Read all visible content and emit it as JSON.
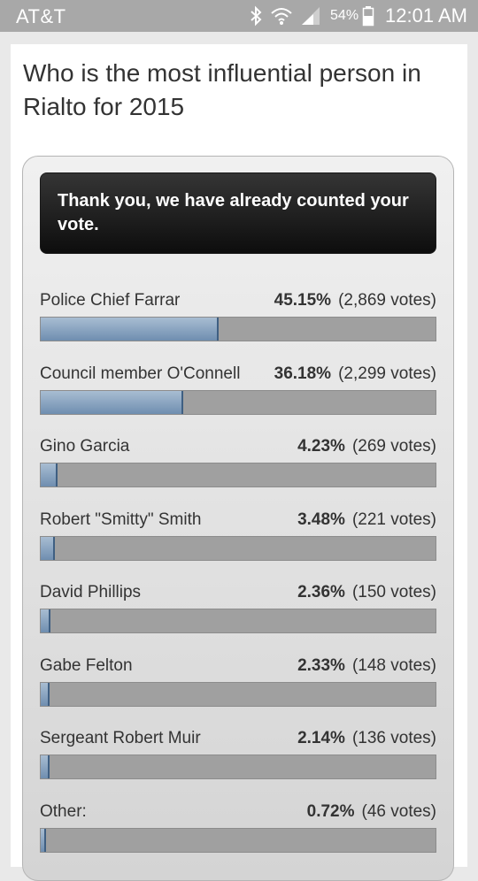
{
  "status_bar": {
    "carrier": "AT&T",
    "icons": [
      "bluetooth-icon",
      "wifi-icon",
      "signal-icon",
      "battery-icon"
    ],
    "battery": "54%",
    "time": "12:01 AM"
  },
  "poll": {
    "question": "Who is the most influential person in Rialto for 2015",
    "message": "Thank you, we have already counted your vote.",
    "colors": {
      "bar_fill": "#7f9cbd",
      "bar_track": "#a0a0a0",
      "message_bg": "#1a1a1a"
    },
    "results": [
      {
        "name": "Police Chief Farrar",
        "percent": "45.15%",
        "votes": "(2,869 votes)",
        "fraction": 0.4515
      },
      {
        "name": "Council member O'Connell",
        "percent": "36.18%",
        "votes": "(2,299 votes)",
        "fraction": 0.3618
      },
      {
        "name": "Gino Garcia",
        "percent": "4.23%",
        "votes": "(269 votes)",
        "fraction": 0.0423
      },
      {
        "name": "Robert \"Smitty\" Smith",
        "percent": "3.48%",
        "votes": "(221 votes)",
        "fraction": 0.0348
      },
      {
        "name": "David Phillips",
        "percent": "2.36%",
        "votes": "(150 votes)",
        "fraction": 0.0236
      },
      {
        "name": "Gabe Felton",
        "percent": "2.33%",
        "votes": "(148 votes)",
        "fraction": 0.0233
      },
      {
        "name": "Sergeant Robert Muir",
        "percent": "2.14%",
        "votes": "(136 votes)",
        "fraction": 0.0214
      },
      {
        "name": "Other:",
        "percent": "0.72%",
        "votes": "(46 votes)",
        "fraction": 0.0072
      }
    ]
  }
}
